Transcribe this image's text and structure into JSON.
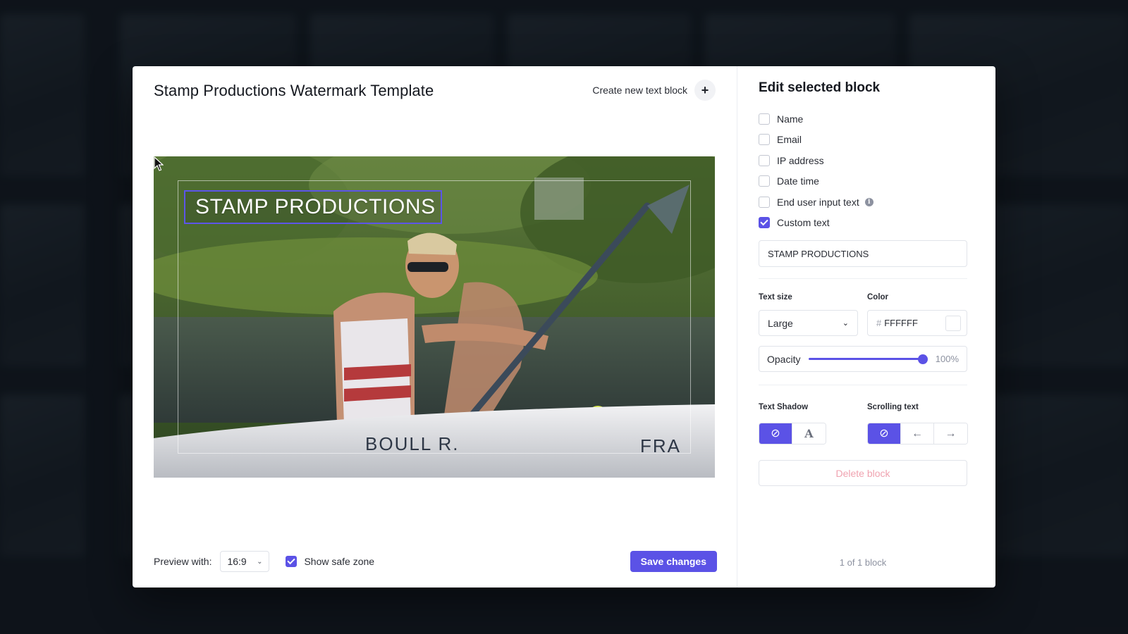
{
  "modal": {
    "title": "Stamp Productions Watermark Template",
    "create_label": "Create new text block",
    "create_icon": "plus-icon"
  },
  "preview": {
    "watermark_text": "STAMP PRODUCTIONS",
    "watermark_border_color": "#5c55e8"
  },
  "footer": {
    "preview_label": "Preview with:",
    "ratio_value": "16:9",
    "safe_zone_label": "Show safe zone",
    "safe_zone_checked": true,
    "save_label": "Save changes"
  },
  "panel": {
    "title": "Edit selected block",
    "fields": [
      {
        "label": "Name",
        "checked": false
      },
      {
        "label": "Email",
        "checked": false
      },
      {
        "label": "IP address",
        "checked": false
      },
      {
        "label": "Date time",
        "checked": false
      },
      {
        "label": "End user input text",
        "checked": false,
        "info": true
      },
      {
        "label": "Custom text",
        "checked": true
      }
    ],
    "custom_text_value": "STAMP PRODUCTIONS",
    "text_size_label": "Text size",
    "text_size_value": "Large",
    "color_label": "Color",
    "color_hash": "#",
    "color_value": "FFFFFF",
    "opacity_label": "Opacity",
    "opacity_value": "100%",
    "opacity_fraction": 1.0,
    "text_shadow_label": "Text Shadow",
    "scrolling_text_label": "Scrolling text",
    "delete_label": "Delete block",
    "block_count": "1 of 1 block"
  },
  "colors": {
    "accent": "#5b52e6",
    "danger_text": "#f0a3b0"
  }
}
